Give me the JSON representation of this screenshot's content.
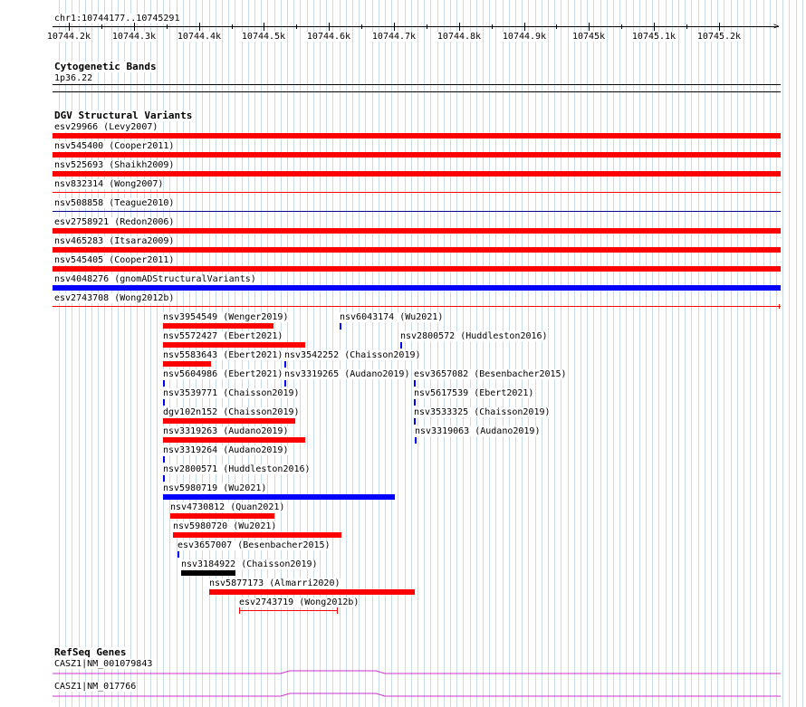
{
  "browser": {
    "location": "chr1:10744177..10745291",
    "ruler_ticks": [
      "10744.2k",
      "10744.3k",
      "10744.4k",
      "10744.5k",
      "10744.6k",
      "10744.7k",
      "10744.8k",
      "10744.9k",
      "10745k",
      "10745.1k",
      "10745.2k"
    ]
  },
  "tracks": {
    "cytoband": {
      "title": "Cytogenetic Bands",
      "band_label": "1p36.22"
    },
    "dgv": {
      "title": "DGV Structural Variants",
      "features": [
        {
          "label": "esv29966 (Levy2007)",
          "color": "#ff0000",
          "style": "thick"
        },
        {
          "label": "nsv545400 (Cooper2011)",
          "color": "#ff0000",
          "style": "thick"
        },
        {
          "label": "nsv525693 (Shaikh2009)",
          "color": "#ff0000",
          "style": "thick"
        },
        {
          "label": "nsv832314 (Wong2007)",
          "color": "#ff0000",
          "style": "thin"
        },
        {
          "label": "nsv508858 (Teague2010)",
          "color": "#00008b",
          "style": "thin"
        },
        {
          "label": "esv2758921 (Redon2006)",
          "color": "#ff0000",
          "style": "thick"
        },
        {
          "label": "nsv465283 (Itsara2009)",
          "color": "#ff0000",
          "style": "thick"
        },
        {
          "label": "nsv545405 (Cooper2011)",
          "color": "#ff0000",
          "style": "thick"
        },
        {
          "label": "nsv4048276 (gnomADStructuralVariants)",
          "color": "#0000ff",
          "style": "thick"
        },
        {
          "label": "esv2743708 (Wong2012b)",
          "color": "#ff0000",
          "style": "thin"
        },
        {
          "label": "nsv3954549 (Wenger2019)",
          "color": "#ff0000",
          "style": "thick"
        },
        {
          "label": "nsv6043174 (Wu2021)",
          "color": "#0000ff",
          "style": "tick"
        },
        {
          "label": "nsv5572427 (Ebert2021)",
          "color": "#ff0000",
          "style": "thick"
        },
        {
          "label": "nsv2800572 (Huddleston2016)",
          "color": "#0000ff",
          "style": "tick"
        },
        {
          "label": "nsv5583643 (Ebert2021)",
          "color": "#ff0000",
          "style": "thick"
        },
        {
          "label": "nsv3542252 (Chaisson2019)",
          "color": "#0000ff",
          "style": "tick"
        },
        {
          "label": "nsv5604986 (Ebert2021)",
          "color": "#0000ff",
          "style": "tick"
        },
        {
          "label": "nsv3319265 (Audano2019)",
          "color": "#0000ff",
          "style": "tick"
        },
        {
          "label": "esv3657082 (Besenbacher2015)",
          "color": "#0000ff",
          "style": "tick"
        },
        {
          "label": "nsv3539771 (Chaisson2019)",
          "color": "#0000ff",
          "style": "tick"
        },
        {
          "label": "nsv5617539 (Ebert2021)",
          "color": "#0000ff",
          "style": "tick"
        },
        {
          "label": "dgv102n152 (Chaisson2019)",
          "color": "#ff0000",
          "style": "thick"
        },
        {
          "label": "nsv3533325 (Chaisson2019)",
          "color": "#0000ff",
          "style": "tick"
        },
        {
          "label": "nsv3319263 (Audano2019)",
          "color": "#ff0000",
          "style": "thick"
        },
        {
          "label": "nsv3319063 (Audano2019)",
          "color": "#0000ff",
          "style": "tick"
        },
        {
          "label": "nsv3319264 (Audano2019)",
          "color": "#0000ff",
          "style": "tick"
        },
        {
          "label": "nsv2800571 (Huddleston2016)",
          "color": "#0000ff",
          "style": "tick"
        },
        {
          "label": "nsv5980719 (Wu2021)",
          "color": "#0000ff",
          "style": "thick"
        },
        {
          "label": "nsv4730812 (Quan2021)",
          "color": "#ff0000",
          "style": "thick"
        },
        {
          "label": "nsv5980720 (Wu2021)",
          "color": "#ff0000",
          "style": "thick"
        },
        {
          "label": "esv3657007 (Besenbacher2015)",
          "color": "#0000ff",
          "style": "tick"
        },
        {
          "label": "nsv3184922 (Chaisson2019)",
          "color": "#000000",
          "style": "thick"
        },
        {
          "label": "nsv5877173 (Almarri2020)",
          "color": "#ff0000",
          "style": "thick"
        },
        {
          "label": "esv2743719 (Wong2012b)",
          "color": "#ff0000",
          "style": "interval"
        }
      ]
    },
    "refseq": {
      "title": "RefSeq Genes",
      "transcripts": [
        {
          "label": "CASZ1|NM_001079843",
          "color": "#cc33cc"
        },
        {
          "label": "CASZ1|NM_017766",
          "color": "#cc33cc"
        }
      ]
    }
  }
}
